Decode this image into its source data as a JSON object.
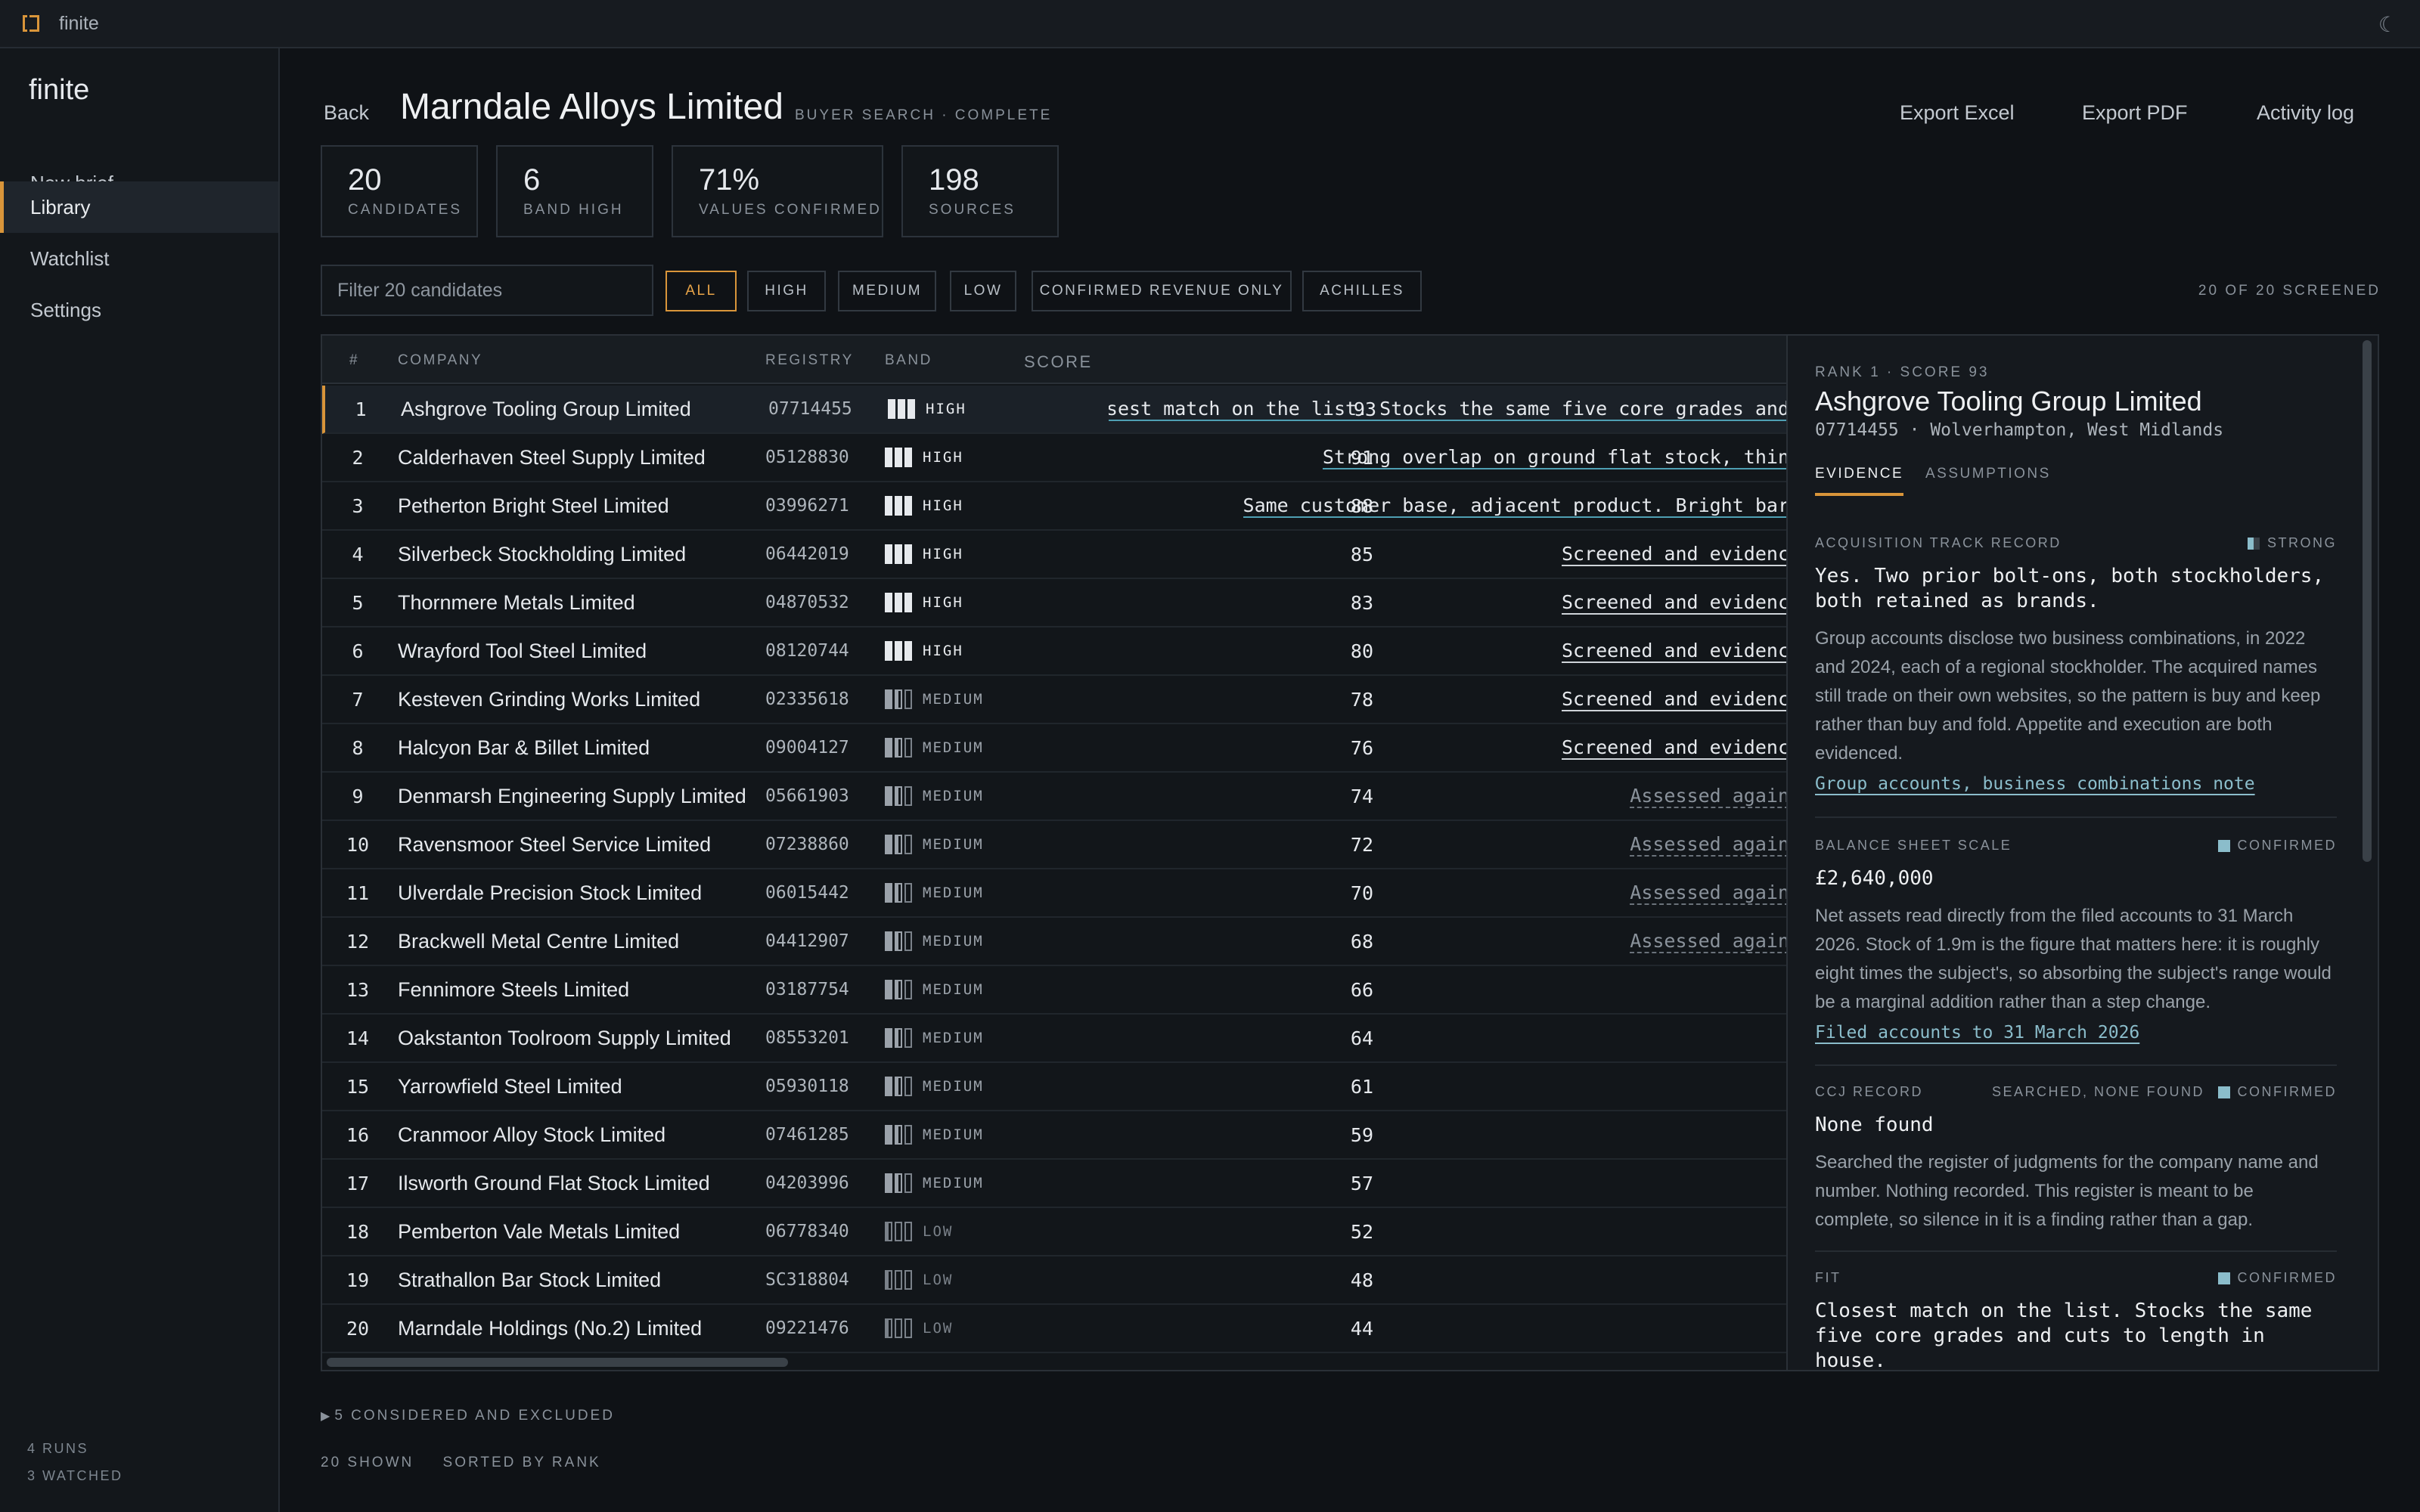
{
  "window": {
    "title": "finite",
    "theme_icon": "moon-icon"
  },
  "sidebar": {
    "brand": "finite",
    "items": [
      {
        "label": "New brief"
      },
      {
        "label": "Library",
        "active": true
      },
      {
        "label": "Watchlist"
      },
      {
        "label": "Settings"
      }
    ],
    "runs": "4 RUNS",
    "watched": "3 WATCHED"
  },
  "header": {
    "back": "Back",
    "title": "Marndale Alloys Limited",
    "status": "BUYER SEARCH · COMPLETE",
    "actions": [
      "Export Excel",
      "Export PDF",
      "Activity log"
    ]
  },
  "stats": [
    {
      "value": "20",
      "label": "CANDIDATES"
    },
    {
      "value": "6",
      "label": "BAND HIGH"
    },
    {
      "value": "71%",
      "label": "VALUES CONFIRMED"
    },
    {
      "value": "198",
      "label": "SOURCES"
    }
  ],
  "filter": {
    "placeholder": "Filter 20 candidates",
    "chips": [
      "ALL",
      "HIGH",
      "MEDIUM",
      "LOW",
      "CONFIRMED REVENUE ONLY",
      "ACHILLES"
    ],
    "active_chip": "ALL",
    "screened": "20 OF 20 SCREENED"
  },
  "table": {
    "columns": [
      "#",
      "COMPANY",
      "REGISTRY",
      "BAND",
      "SCORE"
    ],
    "rows": [
      {
        "rank": "1",
        "company": "Ashgrove Tooling Group Limited",
        "registry": "07714455",
        "band": "HIGH",
        "score": "93",
        "note": "Closest match on the list. Stocks the same five core grades and",
        "note_style": "fit"
      },
      {
        "rank": "2",
        "company": "Calderhaven Steel Supply Limited",
        "registry": "05128830",
        "band": "HIGH",
        "score": "91",
        "note": "Strong overlap on ground flat stock, thin",
        "note_style": "fit"
      },
      {
        "rank": "3",
        "company": "Petherton Bright Steel Limited",
        "registry": "03996271",
        "band": "HIGH",
        "score": "88",
        "note": "Same customer base, adjacent product. Bright bar",
        "note_style": "fit"
      },
      {
        "rank": "4",
        "company": "Silverbeck Stockholding Limited",
        "registry": "06442019",
        "band": "HIGH",
        "score": "85",
        "note": "Screened and evidenc",
        "note_style": "screened"
      },
      {
        "rank": "5",
        "company": "Thornmere Metals Limited",
        "registry": "04870532",
        "band": "HIGH",
        "score": "83",
        "note": "Screened and evidenc",
        "note_style": "screened"
      },
      {
        "rank": "6",
        "company": "Wrayford Tool Steel Limited",
        "registry": "08120744",
        "band": "HIGH",
        "score": "80",
        "note": "Screened and evidenc",
        "note_style": "screened"
      },
      {
        "rank": "7",
        "company": "Kesteven Grinding Works Limited",
        "registry": "02335618",
        "band": "MEDIUM",
        "score": "78",
        "note": "Screened and evidenc",
        "note_style": "screened"
      },
      {
        "rank": "8",
        "company": "Halcyon Bar & Billet Limited",
        "registry": "09004127",
        "band": "MEDIUM",
        "score": "76",
        "note": "Screened and evidenc",
        "note_style": "screened"
      },
      {
        "rank": "9",
        "company": "Denmarsh Engineering Supply Limited",
        "registry": "05661903",
        "band": "MEDIUM",
        "score": "74",
        "note": "Assessed again",
        "note_style": "assessed"
      },
      {
        "rank": "10",
        "company": "Ravensmoor Steel Service Limited",
        "registry": "07238860",
        "band": "MEDIUM",
        "score": "72",
        "note": "Assessed again",
        "note_style": "assessed"
      },
      {
        "rank": "11",
        "company": "Ulverdale Precision Stock Limited",
        "registry": "06015442",
        "band": "MEDIUM",
        "score": "70",
        "note": "Assessed again",
        "note_style": "assessed"
      },
      {
        "rank": "12",
        "company": "Brackwell Metal Centre Limited",
        "registry": "04412907",
        "band": "MEDIUM",
        "score": "68",
        "note": "Assessed again",
        "note_style": "assessed"
      },
      {
        "rank": "13",
        "company": "Fennimore Steels Limited",
        "registry": "03187754",
        "band": "MEDIUM",
        "score": "66",
        "note": "",
        "note_style": "none"
      },
      {
        "rank": "14",
        "company": "Oakstanton Toolroom Supply Limited",
        "registry": "08553201",
        "band": "MEDIUM",
        "score": "64",
        "note": "",
        "note_style": "none"
      },
      {
        "rank": "15",
        "company": "Yarrowfield Steel Limited",
        "registry": "05930118",
        "band": "MEDIUM",
        "score": "61",
        "note": "",
        "note_style": "none"
      },
      {
        "rank": "16",
        "company": "Cranmoor Alloy Stock Limited",
        "registry": "07461285",
        "band": "MEDIUM",
        "score": "59",
        "note": "",
        "note_style": "none"
      },
      {
        "rank": "17",
        "company": "Ilsworth Ground Flat Stock Limited",
        "registry": "04203996",
        "band": "MEDIUM",
        "score": "57",
        "note": "",
        "note_style": "none"
      },
      {
        "rank": "18",
        "company": "Pemberton Vale Metals Limited",
        "registry": "06778340",
        "band": "LOW",
        "score": "52",
        "note": "",
        "note_style": "none"
      },
      {
        "rank": "19",
        "company": "Strathallon Bar Stock Limited",
        "registry": "SC318804",
        "band": "LOW",
        "score": "48",
        "note": "",
        "note_style": "none"
      },
      {
        "rank": "20",
        "company": "Marndale Holdings (No.2) Limited",
        "registry": "09221476",
        "band": "LOW",
        "score": "44",
        "note": "",
        "note_style": "none"
      }
    ]
  },
  "detail": {
    "rank_line": "RANK 1 · SCORE 93",
    "name": "Ashgrove Tooling Group Limited",
    "sub": "07714455 · Wolverhampton, West Midlands",
    "tabs": [
      "EVIDENCE",
      "ASSUMPTIONS"
    ],
    "sections": [
      {
        "label": "ACQUISITION TRACK RECORD",
        "status": "STRONG",
        "answer": "Yes. Two prior bolt-ons, both stockholders, both retained as brands.",
        "body": "Group accounts disclose two business combinations, in 2022 and 2024, each of a regional stockholder. The acquired names still trade on their own websites, so the pattern is buy and keep rather than buy and fold. Appetite and execution are both evidenced.",
        "link": "Group accounts, business combinations note"
      },
      {
        "label": "BALANCE SHEET SCALE",
        "status": "CONFIRMED",
        "answer": "£2,640,000",
        "body": "Net assets read directly from the filed accounts to 31 March 2026. Stock of 1.9m is the figure that matters here: it is roughly eight times the subject's, so absorbing the subject's range would be a marginal addition rather than a step change.",
        "link": "Filed accounts to 31 March 2026"
      },
      {
        "label": "CCJ RECORD",
        "extra": "SEARCHED, NONE FOUND",
        "status": "CONFIRMED",
        "answer": "None found",
        "body": "Searched the register of judgments for the company name and number. Nothing recorded. This register is meant to be complete, so silence in it is a finding rather than a gap."
      },
      {
        "label": "FIT",
        "status": "CONFIRMED",
        "answer": "Closest match on the list. Stocks the same five core grades and cuts to length in house."
      }
    ]
  },
  "footer": {
    "excluded": "5 CONSIDERED AND EXCLUDED",
    "shown": "20 SHOWN",
    "sorted": "SORTED BY RANK"
  },
  "colors": {
    "accent": "#d9953a",
    "link": "#8bbdcb",
    "background": "#0f1216"
  }
}
